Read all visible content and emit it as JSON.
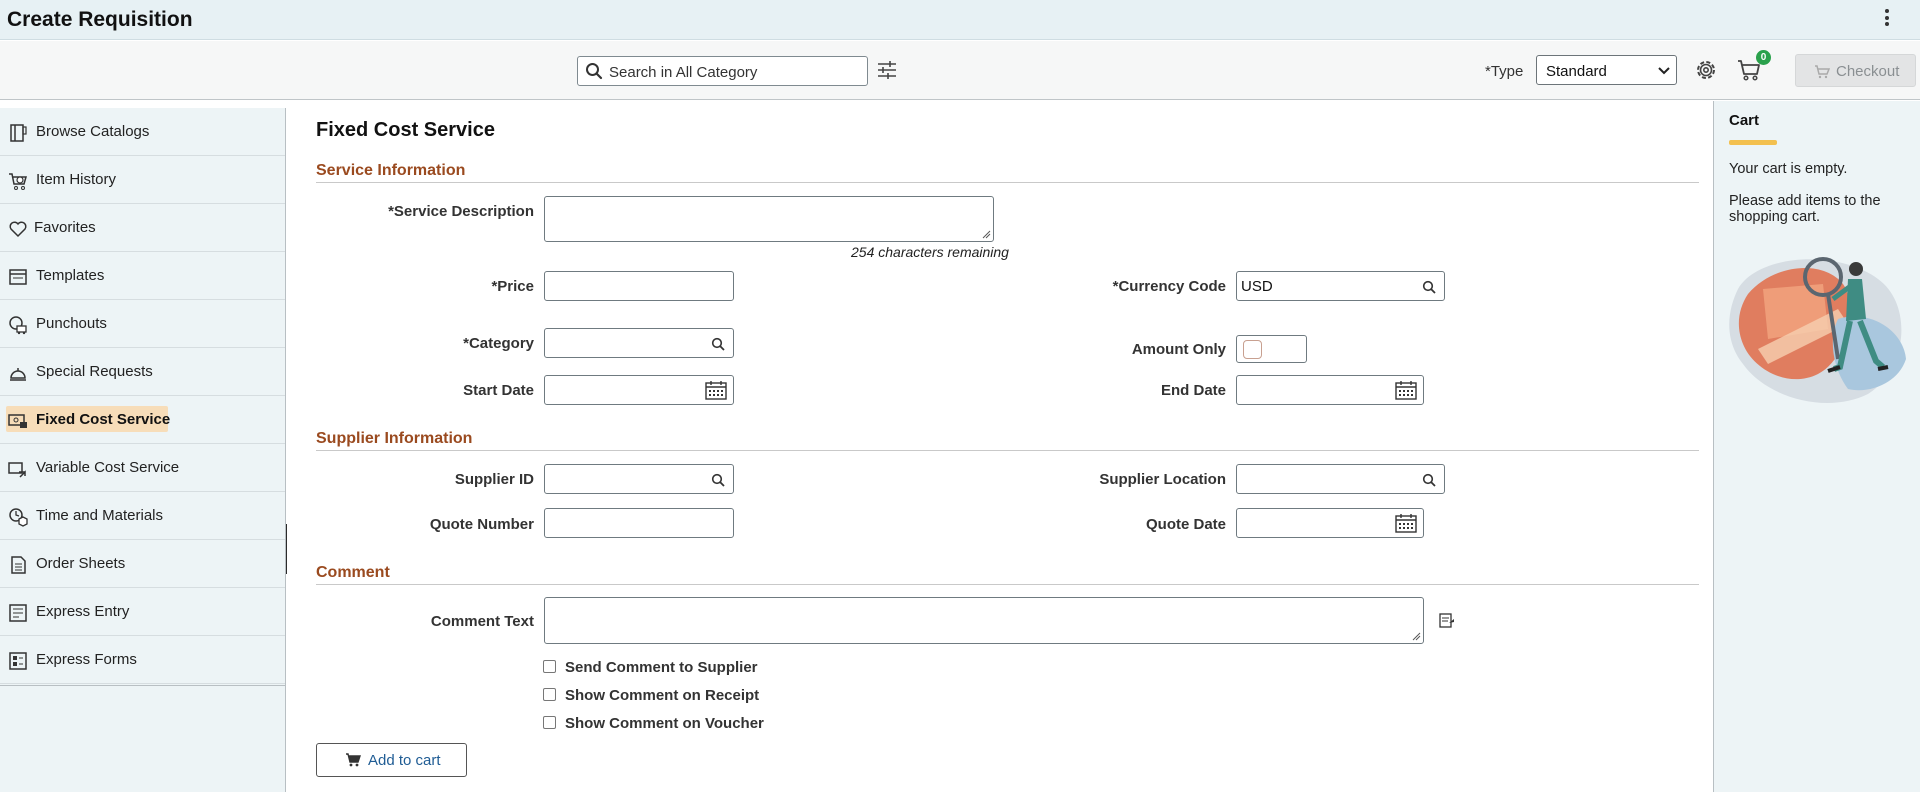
{
  "app": {
    "title": "Create Requisition"
  },
  "toolbar": {
    "search_placeholder": "Search in All Category",
    "type_label": "*Type",
    "type_value": "Standard",
    "cart_count": "0",
    "checkout_label": "Checkout"
  },
  "sidebar": {
    "items": [
      {
        "label": "Browse Catalogs",
        "icon": "catalog-icon"
      },
      {
        "label": "Item History",
        "icon": "cart-history-icon"
      },
      {
        "label": "Favorites",
        "icon": "heart-icon"
      },
      {
        "label": "Templates",
        "icon": "template-icon"
      },
      {
        "label": "Punchouts",
        "icon": "punchout-icon"
      },
      {
        "label": "Special Requests",
        "icon": "bell-icon"
      },
      {
        "label": "Fixed Cost Service",
        "icon": "fixed-cost-icon",
        "active": true
      },
      {
        "label": "Variable Cost Service",
        "icon": "variable-cost-icon"
      },
      {
        "label": "Time and Materials",
        "icon": "time-materials-icon"
      },
      {
        "label": "Order Sheets",
        "icon": "order-sheet-icon"
      },
      {
        "label": "Express Entry",
        "icon": "express-entry-icon"
      },
      {
        "label": "Express Forms",
        "icon": "express-forms-icon"
      }
    ]
  },
  "main": {
    "page_title": "Fixed Cost Service",
    "service_section": "Service Information",
    "service_description_label": "*Service Description",
    "chars_remaining": "254 characters remaining",
    "price_label": "*Price",
    "currency_label": "*Currency Code",
    "currency_value": "USD",
    "category_label": "*Category",
    "amount_only_label": "Amount Only",
    "start_date_label": "Start Date",
    "end_date_label": "End Date",
    "supplier_section": "Supplier Information",
    "supplier_id_label": "Supplier ID",
    "supplier_location_label": "Supplier Location",
    "quote_number_label": "Quote Number",
    "quote_date_label": "Quote Date",
    "comment_section": "Comment",
    "comment_text_label": "Comment Text",
    "send_supplier_label": "Send Comment to Supplier",
    "show_receipt_label": "Show Comment on Receipt",
    "show_voucher_label": "Show Comment on Voucher",
    "add_to_cart_label": "Add to cart"
  },
  "cart": {
    "title": "Cart",
    "empty_text": "Your cart is empty.",
    "message": "Please add items to the shopping cart."
  },
  "colors": {
    "section_heading": "#9a4a1f",
    "active_highlight": "#f7ddb9",
    "badge": "#2aa14c",
    "cart_underline": "#f3c04f"
  }
}
